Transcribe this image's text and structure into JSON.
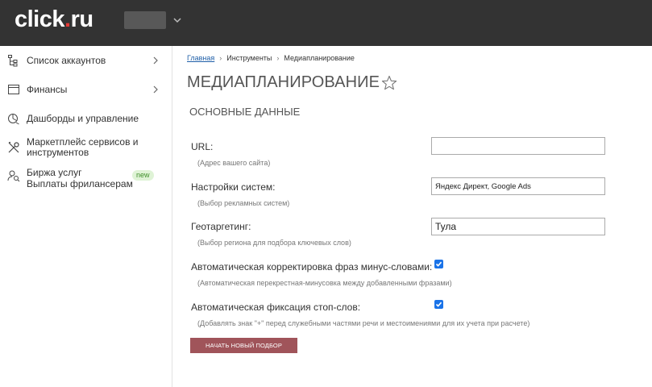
{
  "header": {
    "logo_prefix": "click",
    "logo_dot": ".",
    "logo_suffix": "ru"
  },
  "sidebar": {
    "items": [
      {
        "label": "Список аккаунтов",
        "has_arrow": true,
        "icon": "accounts-tree-icon"
      },
      {
        "label": "Финансы",
        "has_arrow": true,
        "icon": "wallet-icon"
      },
      {
        "label": "Дашборды и управление",
        "has_arrow": false,
        "icon": "dashboard-icon"
      },
      {
        "label": "Маркетплейс сервисов и инструментов",
        "has_arrow": false,
        "icon": "tools-icon"
      },
      {
        "label_line1": "Биржа услуг",
        "label_line2": "Выплаты фрилансерам",
        "badge": "new",
        "has_arrow": false,
        "icon": "person-search-icon"
      }
    ]
  },
  "breadcrumb": {
    "home": "Главная",
    "tools": "Инструменты",
    "current": "Медиапланирование",
    "separator": "›"
  },
  "page": {
    "title": "МЕДИАПЛАНИРОВАНИЕ",
    "section_title": "ОСНОВНЫЕ ДАННЫЕ"
  },
  "form": {
    "url_label": "URL:",
    "url_hint": "(Адрес вашего сайта)",
    "url_value": "",
    "systems_label": "Настройки систем:",
    "systems_hint": "(Выбор рекламных систем)",
    "systems_value": "Яндекс Директ, Google Ads",
    "geo_label": "Геотаргетинг:",
    "geo_hint": "(Выбор региона для подбора ключевых слов)",
    "geo_value": "Тула",
    "minus_label": "Автоматическая корректировка фраз минус-словами:",
    "minus_hint": "(Автоматическая перекрестная-минусовка между добавленными фразами)",
    "minus_checked": true,
    "stop_label": "Автоматическая фиксация стоп-слов:",
    "stop_hint": "(Добавлять знак \"+\" перед служебными частями речи и местоимениями для их учета при расчете)",
    "stop_checked": true,
    "submit_label": "НАЧАТЬ НОВЫЙ ПОДБОР"
  },
  "colors": {
    "topbar": "#333333",
    "logo_dot": "#e53935",
    "accent_button": "#a0545a",
    "checkbox": "#1a73e8",
    "link": "#1f5fa8",
    "badge_bg": "#dff3d6",
    "badge_text": "#3f8f2a"
  }
}
